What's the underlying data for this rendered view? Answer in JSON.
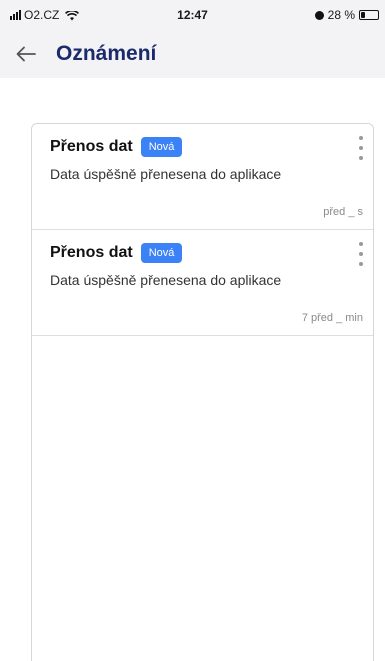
{
  "status_bar": {
    "carrier": "O2.CZ",
    "time": "12:47",
    "battery": "28 %",
    "battery_level": 0.28,
    "icons": [
      "signal-icon",
      "wifi-icon",
      "alarm-icon",
      "battery-icon"
    ]
  },
  "header": {
    "title": "Oznámení",
    "back_icon": "arrow-left-icon"
  },
  "notifications": [
    {
      "title": "Přenos dat",
      "badge": "Nová",
      "text": "Data úspěšně přenesena do aplikace",
      "time": "před _ s"
    },
    {
      "title": "Přenos dat",
      "badge": "Nová",
      "text": "Data úspěšně přenesena do aplikace",
      "time": "7 před _ min"
    }
  ],
  "colors": {
    "accent": "#3b82f6",
    "title": "#1b2a6b",
    "header_bg": "#f3f3f5"
  }
}
